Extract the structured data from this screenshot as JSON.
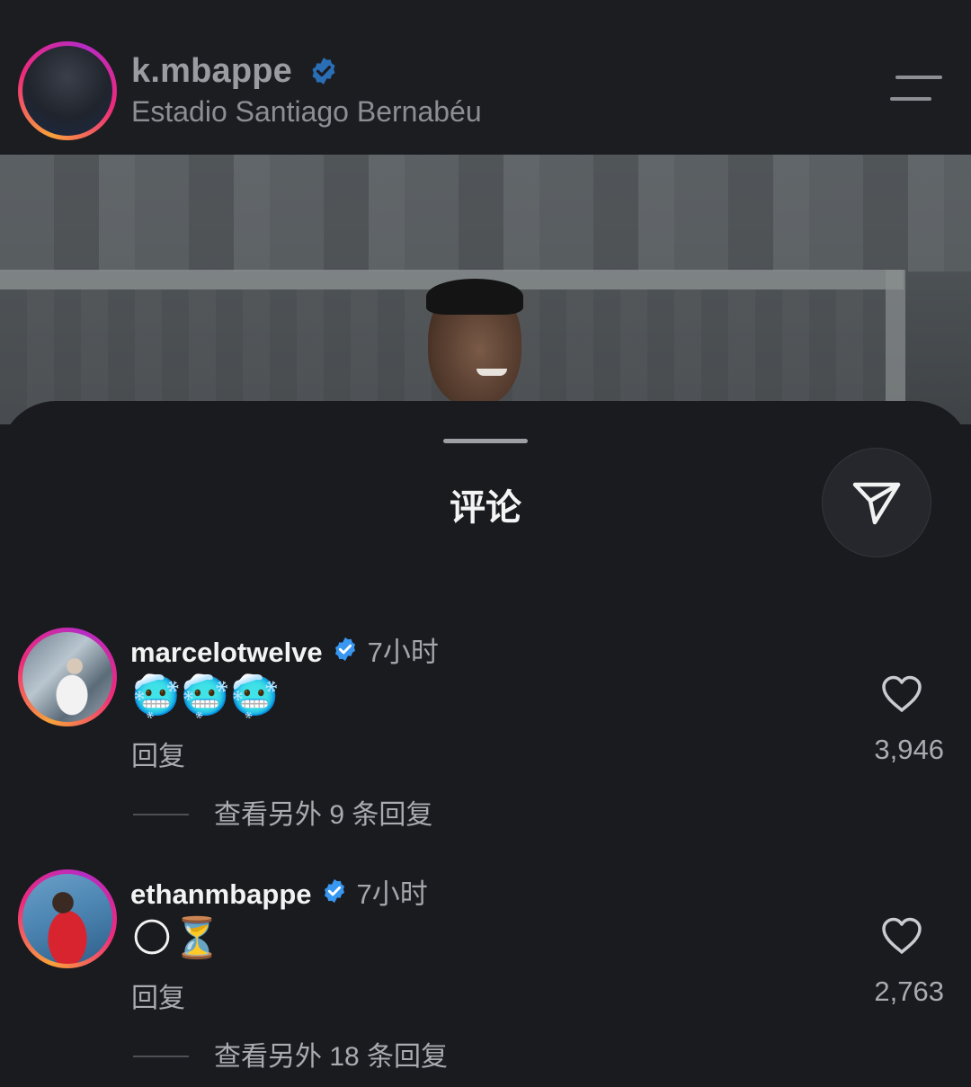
{
  "header": {
    "username": "k.mbappe",
    "location": "Estadio Santiago Bernabéu",
    "avatar_icon": "profile-photo",
    "menu_icon": "menu-icon"
  },
  "sheet": {
    "title": "评论",
    "share_icon": "send-icon"
  },
  "comments": [
    {
      "username": "marcelotwelve",
      "time": "7小时",
      "text": "🥶🥶🥶",
      "reply_label": "回复",
      "likes": "3,946",
      "more_replies": "查看另外 9 条回复"
    },
    {
      "username": "ethanmbappe",
      "time": "7小时",
      "text": "🌕⏳",
      "reply_label": "回复",
      "likes": "2,763",
      "more_replies": "查看另外 18 条回复"
    }
  ],
  "colors": {
    "background": "#1a1b1f",
    "verified": "#3897f0",
    "story_ring_start": "#f9a23a",
    "story_ring_end": "#b62bc4"
  }
}
